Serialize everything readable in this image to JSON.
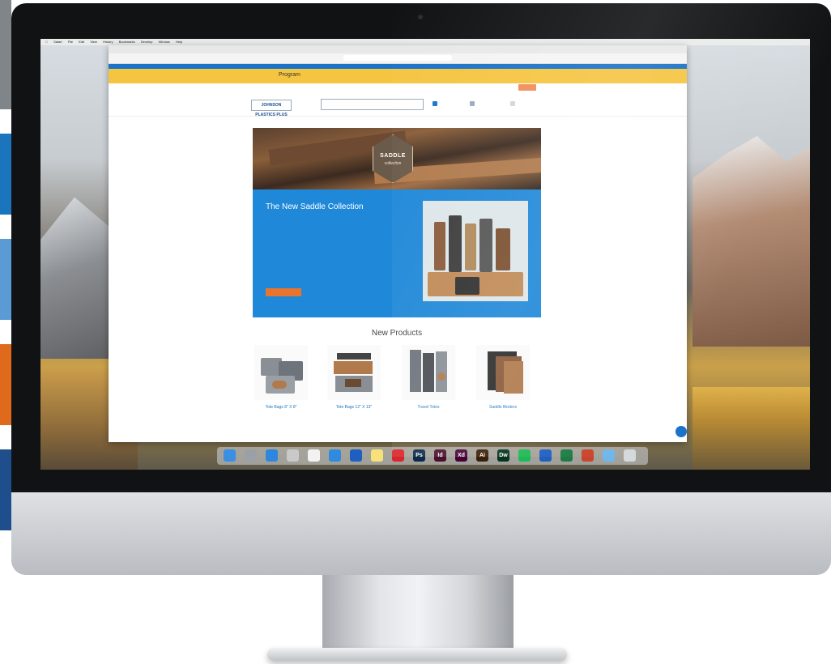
{
  "colors": {
    "strips": [
      "#808589",
      "#ffffff",
      "#1b75bc",
      "#ffffff",
      "#5b9bd5",
      "#ffffff",
      "#e06a1b",
      "#ffffff",
      "#1f4e8c"
    ],
    "brand_blue": "#1a73c8",
    "promo_yellow": "#f5c542",
    "cta_orange": "#e8742d"
  },
  "mac_menubar": {
    "items": [
      "",
      "Safari",
      "File",
      "Edit",
      "View",
      "History",
      "Bookmarks",
      "Develop",
      "Window",
      "Help"
    ]
  },
  "browser": {
    "url": "",
    "shipping_bar": "",
    "brand_name": "",
    "brand_suffix": "Program",
    "promo_text": "",
    "phone": "",
    "nav_items": [
      "",
      "",
      ""
    ],
    "logo": "JOHNSON PLASTICS PLUS",
    "search_placeholder": "",
    "cart_label": "",
    "breadcrumb": ""
  },
  "hero": {
    "badge_title": "SADDLE",
    "badge_subtitle": "collection",
    "title": "The New Saddle Collection",
    "body1": "",
    "body2": "",
    "cta_label": ""
  },
  "new_products": {
    "title": "New Products",
    "items": [
      {
        "name": "Tote Bags 8\" X 8\"",
        "icon": "tote-bag-small-icon"
      },
      {
        "name": "Tote Bags 12\" X 13\"",
        "icon": "tote-bag-large-icon"
      },
      {
        "name": "Travel Totes",
        "icon": "travel-tote-icon"
      },
      {
        "name": "Saddle Binders",
        "icon": "binder-icon"
      }
    ]
  },
  "dock": {
    "apps": [
      {
        "name": "finder",
        "color": "#3a8fe3",
        "label": ""
      },
      {
        "name": "launchpad",
        "color": "#9aa0a6",
        "label": ""
      },
      {
        "name": "app-store",
        "color": "#2e86de",
        "label": ""
      },
      {
        "name": "photos",
        "color": "#c9c9c9",
        "label": ""
      },
      {
        "name": "calendar",
        "color": "#f2f2f2",
        "label": ""
      },
      {
        "name": "safari",
        "color": "#2f8ae0",
        "label": ""
      },
      {
        "name": "outlook",
        "color": "#1f5fbf",
        "label": ""
      },
      {
        "name": "notes",
        "color": "#f7e27a",
        "label": ""
      },
      {
        "name": "acrobat",
        "color": "#d9262c",
        "label": ""
      },
      {
        "name": "photoshop",
        "color": "#0b2a4a",
        "label": "Ps"
      },
      {
        "name": "indesign",
        "color": "#4a0d2a",
        "label": "Id"
      },
      {
        "name": "xd",
        "color": "#450135",
        "label": "Xd"
      },
      {
        "name": "illustrator",
        "color": "#3a1e05",
        "label": "Ai"
      },
      {
        "name": "dreamweaver",
        "color": "#06341f",
        "label": "Dw"
      },
      {
        "name": "spotify",
        "color": "#1db954",
        "label": ""
      },
      {
        "name": "word",
        "color": "#1f5fbf",
        "label": ""
      },
      {
        "name": "excel",
        "color": "#1e7a43",
        "label": ""
      },
      {
        "name": "powerpoint",
        "color": "#c8442b",
        "label": ""
      },
      {
        "name": "folder",
        "color": "#6fb6ea",
        "label": ""
      },
      {
        "name": "trash",
        "color": "#d6d9dc",
        "label": ""
      }
    ]
  }
}
